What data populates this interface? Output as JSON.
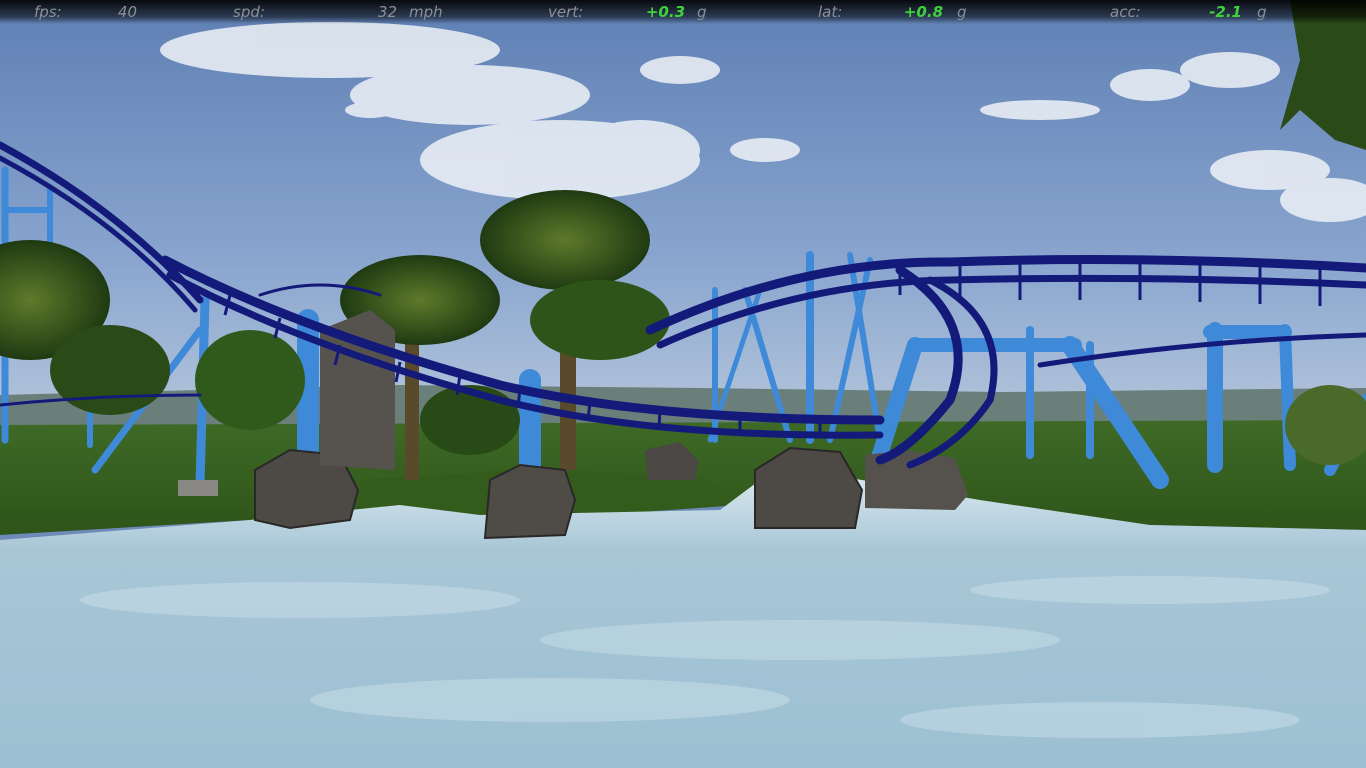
{
  "hud": {
    "fps_label": "fps:",
    "fps_value": "40",
    "spd_label": "spd:",
    "spd_value": "32",
    "spd_unit": "mph",
    "vert_label": "vert:",
    "vert_value": "+0.3",
    "vert_unit": "g",
    "lat_label": "lat:",
    "lat_value": "+0.8",
    "lat_unit": "g",
    "acc_label": "acc:",
    "acc_value": "-2.1",
    "acc_unit": "g"
  },
  "colors": {
    "hud_label": "#8b8f96",
    "hud_value_positive": "#3fd23c",
    "track": "#141a7a",
    "supports": "#3f8ad8",
    "water": "#a9c9d9",
    "grass": "#3c6a22",
    "sky": "#6d8ab8"
  },
  "scene": {
    "description_icons": [
      "coaster-track",
      "support-pillar",
      "palm-tree",
      "rock",
      "water",
      "sky"
    ]
  }
}
